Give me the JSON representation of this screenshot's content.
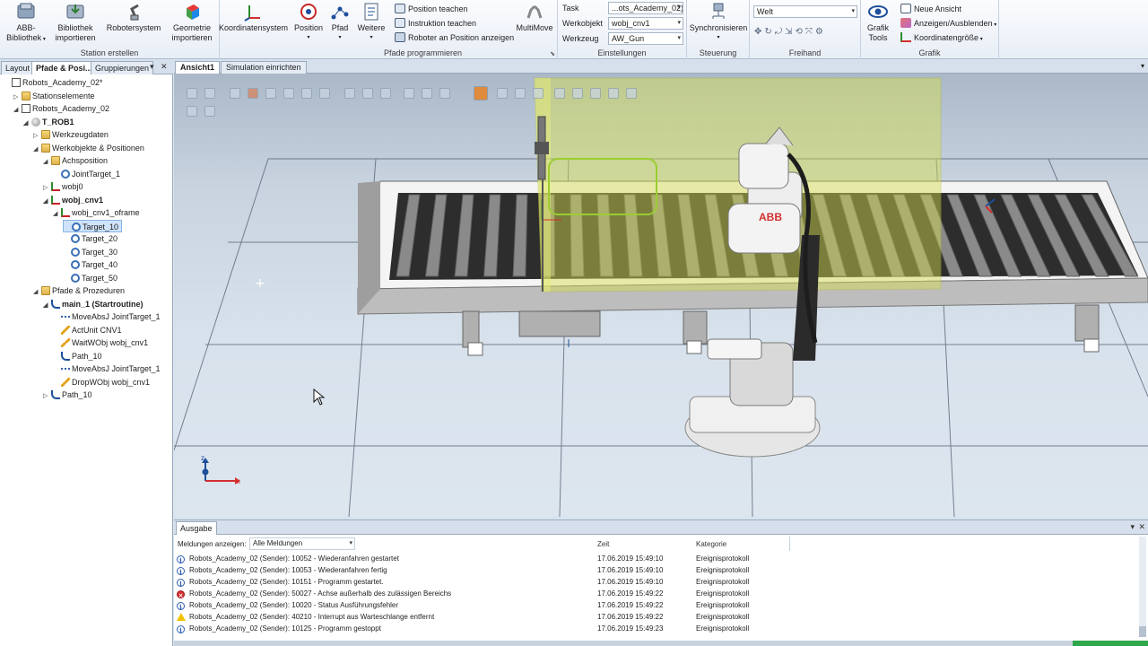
{
  "ribbon": {
    "groups": [
      {
        "title": "Station erstellen"
      },
      {
        "title": "Pfade programmieren"
      },
      {
        "title": "Einstellungen"
      },
      {
        "title": "Steuerung"
      },
      {
        "title": "Freihand"
      },
      {
        "title": "Grafik"
      }
    ],
    "buttons": {
      "abb_bibliothek": "ABB-\nBibliothek",
      "bibliothek_importieren": "Bibliothek\nimportieren",
      "robotersystem": "Robotersystem",
      "geometrie_importieren": "Geometrie\nimportieren",
      "koordinatensystem": "Koordinatensystem",
      "position": "Position",
      "pfad": "Pfad",
      "weitere": "Weitere",
      "position_teachen": "Position teachen",
      "instruktion_teachen": "Instruktion teachen",
      "roboter_an_position": "Roboter an Position anzeigen",
      "multimove": "MultiMove",
      "synchronisieren": "Synchronisieren",
      "grafik_tools": "Grafik\nTools",
      "neue_ansicht": "Neue Ansicht",
      "anzeigen_ausblenden": "Anzeigen/Ausblenden",
      "koordinatengroesse": "Koordinatengröße"
    },
    "settings": {
      "task_label": "Task",
      "task_value": "...ots_Academy_02)",
      "werkobjekt_label": "Werkobjekt",
      "werkobjekt_value": "wobj_cnv1",
      "werkzeug_label": "Werkzeug",
      "werkzeug_value": "AW_Gun"
    },
    "freihand": {
      "frame_value": "Welt"
    }
  },
  "left_panel": {
    "tabs": [
      "Layout",
      "Pfade & Posi...",
      "Gruppierungen"
    ],
    "tree": [
      {
        "label": "Robots_Academy_02*",
        "icon": "station-icon",
        "level": 0,
        "expander": "",
        "bold": false
      },
      {
        "label": "Stationselemente",
        "icon": "folder-icon",
        "level": 1,
        "expander": "▷",
        "bold": false
      },
      {
        "label": "Robots_Academy_02",
        "icon": "controller-icon",
        "level": 1,
        "expander": "◢",
        "bold": false
      },
      {
        "label": "T_ROB1",
        "icon": "robot-icon",
        "level": 2,
        "expander": "◢",
        "bold": true
      },
      {
        "label": "Werkzeugdaten",
        "icon": "folder-icon",
        "level": 3,
        "expander": "▷",
        "bold": false
      },
      {
        "label": "Werkobjekte & Positionen",
        "icon": "folder-icon",
        "level": 3,
        "expander": "◢",
        "bold": false
      },
      {
        "label": "Achsposition",
        "icon": "folder-icon",
        "level": 4,
        "expander": "◢",
        "bold": false
      },
      {
        "label": "JointTarget_1",
        "icon": "jointtarget-icon",
        "level": 5,
        "expander": "",
        "bold": false
      },
      {
        "label": "wobj0",
        "icon": "workobject-icon",
        "level": 4,
        "expander": "▷",
        "bold": false
      },
      {
        "label": "wobj_cnv1",
        "icon": "workobject-icon",
        "level": 4,
        "expander": "◢",
        "bold": true
      },
      {
        "label": "wobj_cnv1_oframe",
        "icon": "workobject-icon",
        "level": 5,
        "expander": "◢",
        "bold": false
      },
      {
        "label": "Target_10",
        "icon": "target-icon",
        "level": 6,
        "expander": "",
        "bold": false,
        "selected": true
      },
      {
        "label": "Target_20",
        "icon": "target-icon",
        "level": 6,
        "expander": "",
        "bold": false
      },
      {
        "label": "Target_30",
        "icon": "target-icon",
        "level": 6,
        "expander": "",
        "bold": false
      },
      {
        "label": "Target_40",
        "icon": "target-icon",
        "level": 6,
        "expander": "",
        "bold": false
      },
      {
        "label": "Target_50",
        "icon": "target-icon",
        "level": 6,
        "expander": "",
        "bold": false
      },
      {
        "label": "Pfade & Prozeduren",
        "icon": "folder-icon",
        "level": 3,
        "expander": "◢",
        "bold": false
      },
      {
        "label": "main_1 (Startroutine)",
        "icon": "path-icon",
        "level": 4,
        "expander": "◢",
        "bold": true
      },
      {
        "label": "MoveAbsJ JointTarget_1",
        "icon": "move-icon",
        "level": 5,
        "expander": "",
        "bold": false
      },
      {
        "label": "ActUnit CNV1",
        "icon": "action-icon",
        "level": 5,
        "expander": "",
        "bold": false
      },
      {
        "label": "WaitWObj wobj_cnv1",
        "icon": "action-icon",
        "level": 5,
        "expander": "",
        "bold": false
      },
      {
        "label": "Path_10",
        "icon": "path-icon",
        "level": 5,
        "expander": "",
        "bold": false
      },
      {
        "label": "MoveAbsJ JointTarget_1",
        "icon": "move-icon",
        "level": 5,
        "expander": "",
        "bold": false
      },
      {
        "label": "DropWObj wobj_cnv1",
        "icon": "action-icon",
        "level": 5,
        "expander": "",
        "bold": false
      },
      {
        "label": "Path_10",
        "icon": "path-icon",
        "level": 4,
        "expander": "▷",
        "bold": false
      }
    ]
  },
  "viewport": {
    "tabs": [
      "Ansicht1",
      "Simulation einrichten"
    ],
    "robot_logo": "ABB",
    "axis_x": "x",
    "axis_z": "z"
  },
  "output": {
    "tab": "Ausgabe",
    "filter_label": "Meldungen anzeigen:",
    "filter_value": "Alle Meldungen",
    "col_time": "Zeit",
    "col_category": "Kategorie",
    "rows": [
      {
        "type": "info",
        "message": "Robots_Academy_02 (Sender): 10052 - Wiederanfahren gestartet",
        "time": "17.06.2019 15:49:10",
        "category": "Ereignisprotokoll"
      },
      {
        "type": "info",
        "message": "Robots_Academy_02 (Sender): 10053 - Wiederanfahren fertig",
        "time": "17.06.2019 15:49:10",
        "category": "Ereignisprotokoll"
      },
      {
        "type": "info",
        "message": "Robots_Academy_02 (Sender): 10151 - Programm gestartet.",
        "time": "17.06.2019 15:49:10",
        "category": "Ereignisprotokoll"
      },
      {
        "type": "error",
        "message": "Robots_Academy_02 (Sender): 50027 - Achse außerhalb des zulässigen Bereichs",
        "time": "17.06.2019 15:49:22",
        "category": "Ereignisprotokoll"
      },
      {
        "type": "info",
        "message": "Robots_Academy_02 (Sender): 10020 - Status Ausführungsfehler",
        "time": "17.06.2019 15:49:22",
        "category": "Ereignisprotokoll"
      },
      {
        "type": "warning",
        "message": "Robots_Academy_02 (Sender): 40210 - Interrupt aus Warteschlange entfernt",
        "time": "17.06.2019 15:49:22",
        "category": "Ereignisprotokoll"
      },
      {
        "type": "info",
        "message": "Robots_Academy_02 (Sender): 10125 - Programm gestoppt",
        "time": "17.06.2019 15:49:23",
        "category": "Ereignisprotokoll"
      }
    ]
  },
  "colors": {
    "accent": "#2f5fb0",
    "selection": "#cfe3fa",
    "error": "#d32f2f",
    "warning": "#f2c200",
    "target_box": "#d8e04a"
  }
}
